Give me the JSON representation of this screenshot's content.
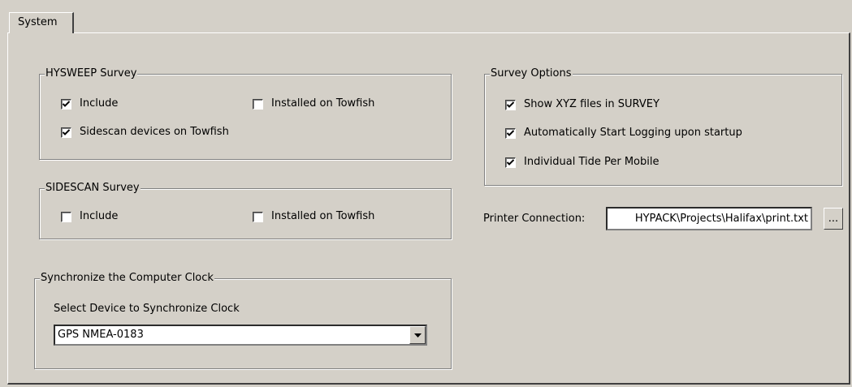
{
  "tab": {
    "label": "System"
  },
  "hysweep": {
    "legend": "HYSWEEP Survey",
    "include": {
      "label": "Include",
      "checked": true
    },
    "towfish": {
      "label": "Installed on Towfish",
      "checked": false
    },
    "sidescan": {
      "label": "Sidescan devices on Towfish",
      "checked": true
    }
  },
  "sidescan_survey": {
    "legend": "SIDESCAN Survey",
    "include": {
      "label": "Include",
      "checked": false
    },
    "towfish": {
      "label": "Installed on Towfish",
      "checked": false
    }
  },
  "sync": {
    "legend": "Synchronize the Computer Clock",
    "prompt": "Select Device to Synchronize Clock",
    "selected": "GPS NMEA-0183"
  },
  "survey_options": {
    "legend": "Survey Options",
    "show_xyz": {
      "label": "Show XYZ files in SURVEY",
      "checked": true
    },
    "auto_log": {
      "label": "Automatically Start Logging upon startup",
      "checked": true
    },
    "tide": {
      "label": "Individual Tide Per  Mobile",
      "checked": true
    }
  },
  "printer": {
    "label": "Printer Connection:",
    "value": "HYPACK\\Projects\\Halifax\\print.txt",
    "browse_label": "..."
  }
}
